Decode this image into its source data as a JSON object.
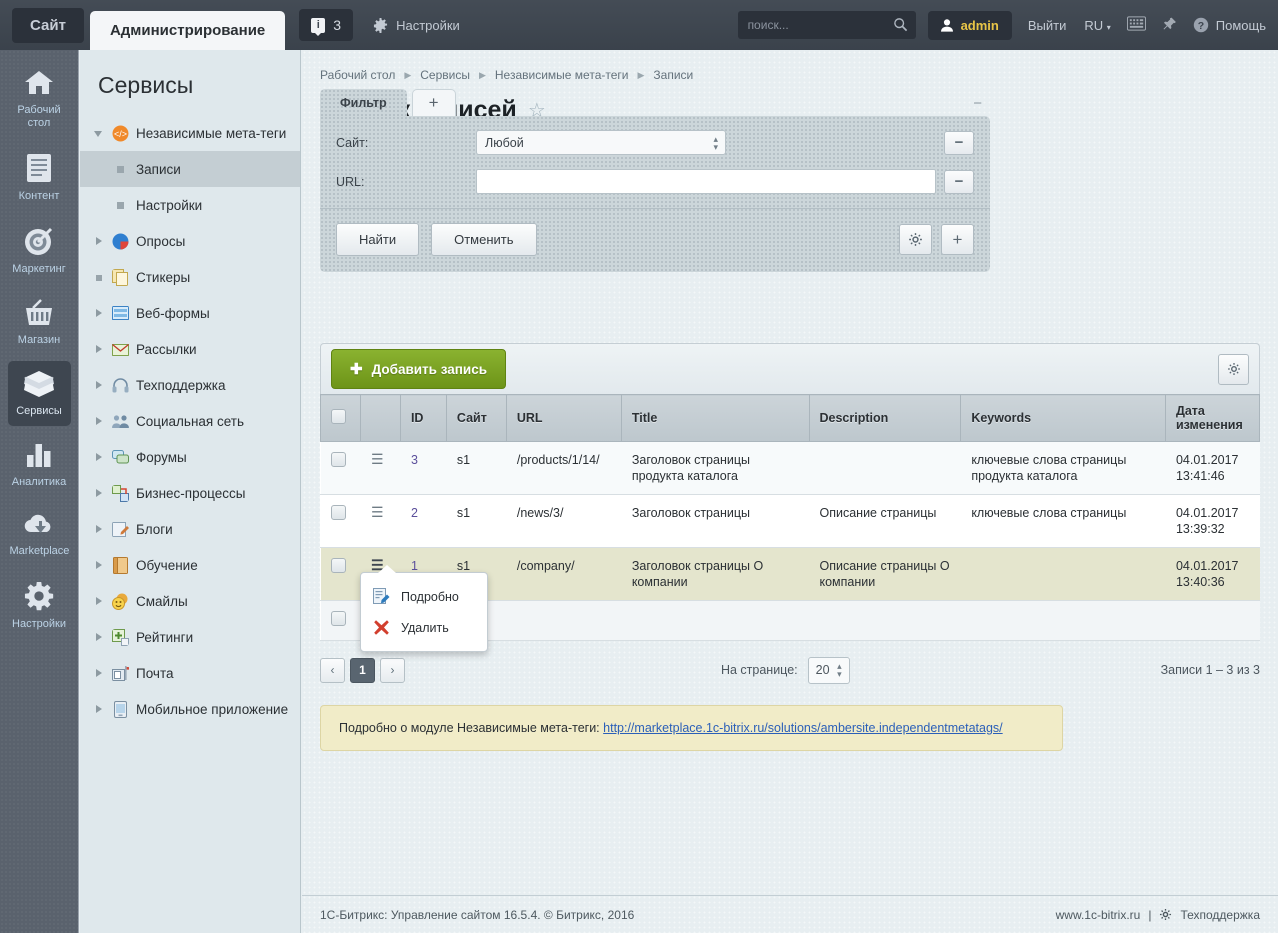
{
  "topbar": {
    "site_tab": "Сайт",
    "admin_tab": "Администрирование",
    "badge_count": "3",
    "settings_label": "Настройки",
    "search_placeholder": "поиск...",
    "user_name": "admin",
    "logout": "Выйти",
    "lang": "RU",
    "help": "Помощь"
  },
  "rail": {
    "items": [
      {
        "label": "Рабочий стол",
        "icon": "home-icon",
        "active": false
      },
      {
        "label": "Контент",
        "icon": "document-icon",
        "active": false
      },
      {
        "label": "Маркетинг",
        "icon": "target-icon",
        "active": false
      },
      {
        "label": "Магазин",
        "icon": "basket-icon",
        "active": false
      },
      {
        "label": "Сервисы",
        "icon": "layers-icon",
        "active": true
      },
      {
        "label": "Аналитика",
        "icon": "bars-icon",
        "active": false
      },
      {
        "label": "Marketplace",
        "icon": "cloud-download-icon",
        "active": false
      },
      {
        "label": "Настройки",
        "icon": "gear-icon",
        "active": false
      }
    ]
  },
  "menu": {
    "title": "Сервисы",
    "items": [
      {
        "label": "Независимые мета-теги",
        "state": "expanded",
        "icon_color": "#f0892a"
      },
      {
        "label": "Записи",
        "state": "child",
        "selected": true
      },
      {
        "label": "Настройки",
        "state": "child",
        "selected": false
      },
      {
        "label": "Опросы",
        "state": "collapsed",
        "icon_color": "#2f7fd0"
      },
      {
        "label": "Стикеры",
        "state": "leaf",
        "icon_color": "#e8c96a"
      },
      {
        "label": "Веб-формы",
        "state": "collapsed",
        "icon_color": "#4a90d9"
      },
      {
        "label": "Рассылки",
        "state": "collapsed",
        "icon_color": "#9ec36a"
      },
      {
        "label": "Техподдержка",
        "state": "collapsed",
        "icon_color": "#93a3b0"
      },
      {
        "label": "Социальная сеть",
        "state": "collapsed",
        "icon_color": "#6e8aa8"
      },
      {
        "label": "Форумы",
        "state": "collapsed",
        "icon_color": "#6fc0d0"
      },
      {
        "label": "Бизнес-процессы",
        "state": "collapsed",
        "icon_color": "#7fae5a"
      },
      {
        "label": "Блоги",
        "state": "collapsed",
        "icon_color": "#c9d4dd"
      },
      {
        "label": "Обучение",
        "state": "collapsed",
        "icon_color": "#e09a3c"
      },
      {
        "label": "Смайлы",
        "state": "collapsed",
        "icon_color": "#f2c84b"
      },
      {
        "label": "Рейтинги",
        "state": "collapsed",
        "icon_color": "#8fc46a"
      },
      {
        "label": "Почта",
        "state": "collapsed",
        "icon_color": "#8fa3b5"
      },
      {
        "label": "Мобильное приложение",
        "state": "collapsed",
        "icon_color": "#9fb3c4"
      }
    ]
  },
  "breadcrumb": [
    "Рабочий стол",
    "Сервисы",
    "Независимые мета-теги",
    "Записи"
  ],
  "page": {
    "title": "Список записей"
  },
  "filter": {
    "tab_label": "Фильтр",
    "add_tab_label": "+",
    "collapse_label": "−",
    "site_label": "Сайт:",
    "site_value": "Любой",
    "url_label": "URL:",
    "url_value": "",
    "find_label": "Найти",
    "cancel_label": "Отменить",
    "settings_icon": "gear-icon",
    "add_icon": "plus-icon",
    "remove_icon": "minus-icon"
  },
  "grid": {
    "add_button": "Добавить запись",
    "settings_icon": "gear-icon",
    "columns": [
      "",
      "",
      "ID",
      "Сайт",
      "URL",
      "Title",
      "Description",
      "Keywords",
      "Дата изменения"
    ],
    "rows": [
      {
        "id": "3",
        "site": "s1",
        "url": "/products/1/14/",
        "title": "Заголовок страницы продукта каталога",
        "description": "",
        "keywords": "ключевые слова страницы продукта каталога",
        "date": "04.01.2017 13:41:46"
      },
      {
        "id": "2",
        "site": "s1",
        "url": "/news/3/",
        "title": "Заголовок страницы",
        "description": "Описание страницы",
        "keywords": "ключевые слова страницы",
        "date": "04.01.2017 13:39:32"
      },
      {
        "id": "1",
        "site": "s1",
        "url": "/company/",
        "title": "Заголовок страницы О компании",
        "description": "Описание страницы О компании",
        "keywords": "",
        "date": "04.01.2017 13:40:36"
      }
    ]
  },
  "context_menu": {
    "items": [
      {
        "label": "Подробно",
        "icon": "edit-doc-icon"
      },
      {
        "label": "Удалить",
        "icon": "delete-x-icon"
      }
    ]
  },
  "pager": {
    "prev": "‹",
    "current": "1",
    "next": "›",
    "per_page_label": "На странице:",
    "per_page_value": "20",
    "summary": "Записи 1 – 3 из 3"
  },
  "note": {
    "text": "Подробно о модуле Независимые мета-теги: ",
    "link": "http://marketplace.1c-bitrix.ru/solutions/ambersite.independentmetatags/"
  },
  "footer": {
    "left": "1С-Битрикс: Управление сайтом 16.5.4. © Битрикс, 2016",
    "site": "www.1c-bitrix.ru",
    "divider": "|",
    "support": "Техподдержка"
  }
}
